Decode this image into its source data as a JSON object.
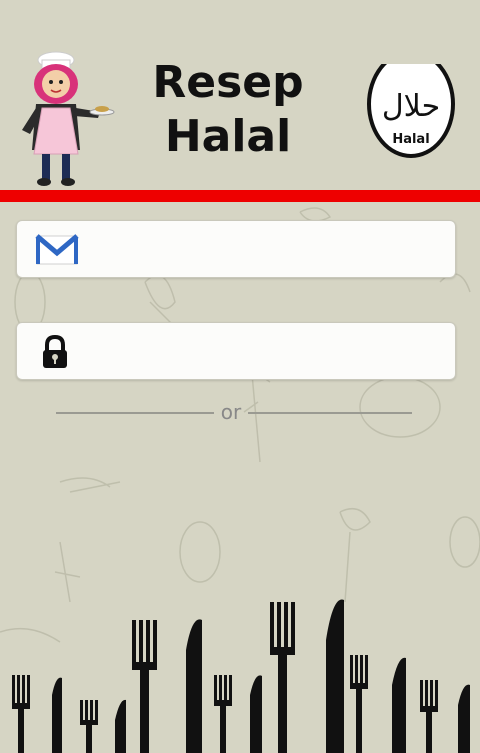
{
  "header": {
    "title_line1": "Resep",
    "title_line2": "Halal",
    "halal_logo_arabic": "حلال",
    "halal_logo_label": "Halal"
  },
  "login": {
    "email_value": "",
    "password_value": "",
    "separator_text": "or"
  },
  "icons": {
    "email": "gmail-envelope-icon",
    "password": "padlock-icon",
    "chef": "chef-girl-illustration",
    "cutlery": "forks-knives-silhouette"
  },
  "colors": {
    "background": "#d6d5c4",
    "accent_bar": "#ee0000",
    "field_bg": "#fcfcfa",
    "cutlery": "#111111"
  }
}
